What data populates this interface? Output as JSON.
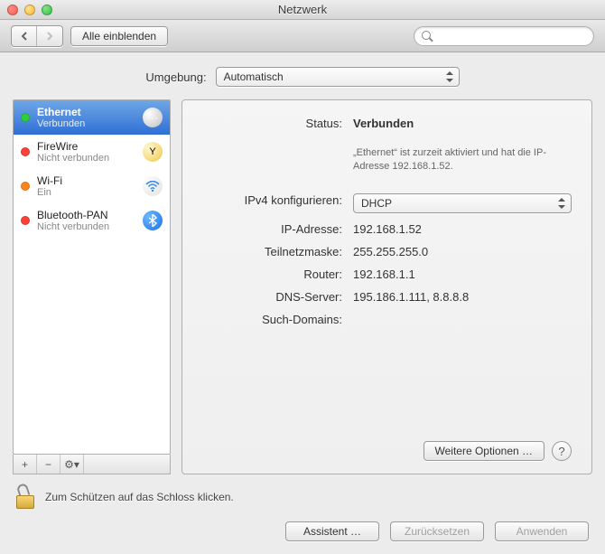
{
  "title": "Netzwerk",
  "toolbar": {
    "back_tip": "Zurück",
    "fwd_tip": "Vor",
    "show_all": "Alle einblenden",
    "search_placeholder": ""
  },
  "environment": {
    "label": "Umgebung:",
    "value": "Automatisch"
  },
  "interfaces": [
    {
      "name": "Ethernet",
      "status_text": "Verbunden",
      "dot": "green",
      "selected": true,
      "icon": "ethernet"
    },
    {
      "name": "FireWire",
      "status_text": "Nicht verbunden",
      "dot": "red",
      "selected": false,
      "icon": "firewire"
    },
    {
      "name": "Wi-Fi",
      "status_text": "Ein",
      "dot": "amber",
      "selected": false,
      "icon": "wifi"
    },
    {
      "name": "Bluetooth-PAN",
      "status_text": "Nicht verbunden",
      "dot": "red",
      "selected": false,
      "icon": "bluetooth"
    }
  ],
  "sidebar_footer": {
    "add": "+",
    "remove": "−",
    "action": "⚙︎▾"
  },
  "detail": {
    "status_label": "Status:",
    "status_value": "Verbunden",
    "status_desc": "„Ethernet“ ist zurzeit aktiviert und hat die IP-Adresse 192.168.1.52.",
    "ipv4_config_label": "IPv4 konfigurieren:",
    "ipv4_config_value": "DHCP",
    "ip_label": "IP-Adresse:",
    "ip_value": "192.168.1.52",
    "mask_label": "Teilnetzmaske:",
    "mask_value": "255.255.255.0",
    "router_label": "Router:",
    "router_value": "192.168.1.1",
    "dns_label": "DNS-Server:",
    "dns_value": "195.186.1.111, 8.8.8.8",
    "search_label": "Such-Domains:",
    "search_value": "",
    "advanced_button": "Weitere Optionen …",
    "help": "?"
  },
  "lock": {
    "text": "Zum Schützen auf das Schloss klicken."
  },
  "buttons": {
    "assistant": "Assistent …",
    "revert": "Zurücksetzen",
    "apply": "Anwenden"
  }
}
